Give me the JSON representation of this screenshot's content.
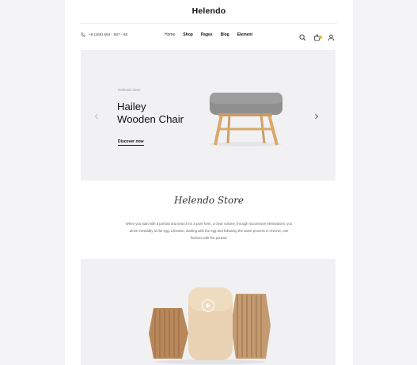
{
  "brand": "Helendo",
  "header": {
    "phone": "+8 (268) 654 - 587 - 68",
    "nav": [
      "Home",
      "Shop",
      "Pages",
      "Blog",
      "Element"
    ]
  },
  "hero": {
    "subtitle": "Helendo store",
    "title_line1": "Hailey",
    "title_line2": "Wooden Chair",
    "cta": "Discover now"
  },
  "about": {
    "signature": "Helendo Store",
    "description": "When you start with a portrait and search for a pure form, a clear volume, through successive eliminations, you arrive inevitably at the egg. Likewise, starting with the egg and following the same process in reverse, one finishes with the portrait."
  },
  "colors": {
    "accent": "#e2b53a",
    "background": "#f3f3f6",
    "panel": "#f1f1f3"
  },
  "icons": [
    "phone-icon",
    "search-icon",
    "cart-icon",
    "user-icon",
    "chevron-left-icon",
    "chevron-right-icon",
    "play-icon"
  ]
}
